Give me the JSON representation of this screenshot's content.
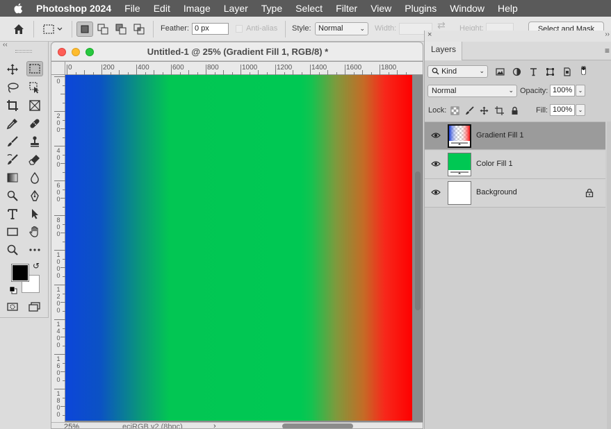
{
  "menubar": {
    "app_name": "Photoshop 2024",
    "items": [
      "File",
      "Edit",
      "Image",
      "Layer",
      "Type",
      "Select",
      "Filter",
      "View",
      "Plugins",
      "Window",
      "Help"
    ]
  },
  "options_bar": {
    "feather_label": "Feather:",
    "feather_value": "0 px",
    "antialias_label": "Anti-alias",
    "style_label": "Style:",
    "style_value": "Normal",
    "width_label": "Width:",
    "height_label": "Height:",
    "select_mask_label": "Select and Mask"
  },
  "tools": [
    {
      "name": "move-tool",
      "icon": "move-icon"
    },
    {
      "name": "marquee-tool",
      "icon": "rect-marquee-icon",
      "active": true
    },
    {
      "name": "lasso-tool",
      "icon": "lasso-icon"
    },
    {
      "name": "object-select-tool",
      "icon": "object-select-icon"
    },
    {
      "name": "crop-tool",
      "icon": "crop-icon"
    },
    {
      "name": "frame-tool",
      "icon": "frame-icon"
    },
    {
      "name": "eyedropper-tool",
      "icon": "eyedropper-icon"
    },
    {
      "name": "healing-tool",
      "icon": "healing-icon"
    },
    {
      "name": "brush-tool",
      "icon": "brush-icon"
    },
    {
      "name": "stamp-tool",
      "icon": "stamp-icon"
    },
    {
      "name": "history-brush-tool",
      "icon": "history-brush-icon"
    },
    {
      "name": "eraser-tool",
      "icon": "eraser-icon"
    },
    {
      "name": "gradient-tool",
      "icon": "gradient-icon"
    },
    {
      "name": "blur-tool",
      "icon": "blur-icon"
    },
    {
      "name": "dodge-tool",
      "icon": "dodge-icon"
    },
    {
      "name": "pen-tool",
      "icon": "pen-icon"
    },
    {
      "name": "type-tool",
      "icon": "type-icon"
    },
    {
      "name": "path-select-tool",
      "icon": "path-select-icon"
    },
    {
      "name": "shape-tool",
      "icon": "rectangle-icon"
    },
    {
      "name": "hand-tool",
      "icon": "hand-icon"
    },
    {
      "name": "zoom-tool",
      "icon": "zoom-icon"
    },
    {
      "name": "more-tools",
      "icon": "ellipsis-icon"
    }
  ],
  "document": {
    "title": "Untitled-1 @ 25% (Gradient Fill 1, RGB/8) *",
    "zoom": "25%",
    "profile": "eciRGB v2 (8bpc)",
    "ruler_h_labels": [
      "0",
      "200",
      "400",
      "600",
      "800",
      "1000",
      "1200",
      "1400",
      "1600",
      "1800"
    ],
    "ruler_v_labels": [
      "0",
      "200",
      "400",
      "600",
      "800",
      "1000",
      "1200",
      "1400",
      "1600",
      "1800"
    ],
    "gradient_colors": [
      "#0c46d9",
      "#00c853",
      "#fe0000"
    ]
  },
  "layers_panel": {
    "tab_label": "Layers",
    "filter_value": "Kind",
    "blend_mode": "Normal",
    "opacity_label": "Opacity:",
    "opacity_value": "100%",
    "lock_label": "Lock:",
    "fill_label": "Fill:",
    "fill_value": "100%",
    "layers": [
      {
        "name": "Gradient Fill 1",
        "selected": true,
        "visible": true
      },
      {
        "name": "Color Fill 1",
        "selected": false,
        "visible": true,
        "color": "#00c853"
      },
      {
        "name": "Background",
        "selected": false,
        "visible": true,
        "locked": true
      }
    ]
  }
}
